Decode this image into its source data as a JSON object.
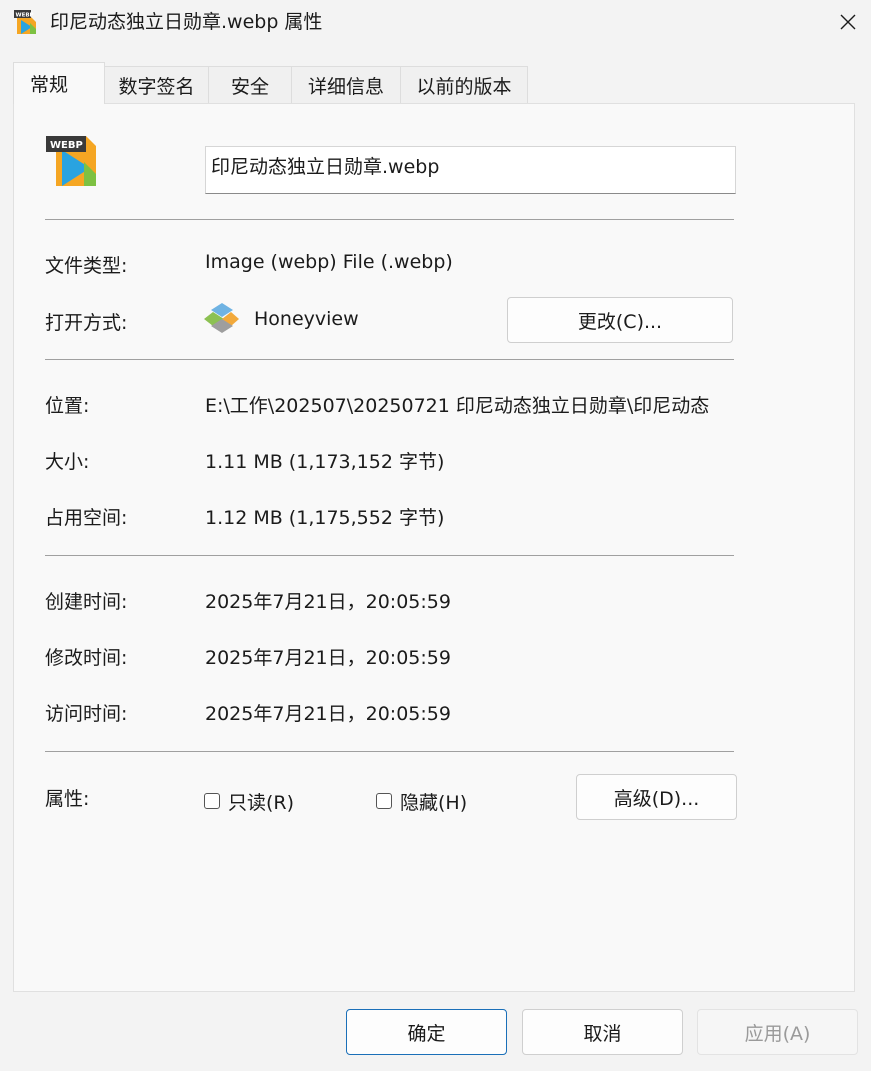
{
  "window": {
    "title": "印尼动态独立日勋章.webp 属性",
    "app_icon": "webp-file-icon",
    "close_icon": "close-icon"
  },
  "tabs": [
    {
      "label": "常规",
      "active": true
    },
    {
      "label": "数字签名",
      "active": false
    },
    {
      "label": "安全",
      "active": false
    },
    {
      "label": "详细信息",
      "active": false
    },
    {
      "label": "以前的版本",
      "active": false
    }
  ],
  "general": {
    "file_icon_badge": "WEBP",
    "file_name": "印尼动态独立日勋章.webp",
    "file_type_label": "文件类型:",
    "file_type_value": "Image (webp) File (.webp)",
    "opens_with_label": "打开方式:",
    "opens_with_app": "Honeyview",
    "change_button": "更改(C)...",
    "location_label": "位置:",
    "location_value": "E:\\工作\\202507\\20250721 印尼动态独立日勋章\\印尼动态",
    "size_label": "大小:",
    "size_value": "1.11 MB (1,173,152 字节)",
    "size_on_disk_label": "占用空间:",
    "size_on_disk_value": "1.12 MB (1,175,552 字节)",
    "created_label": "创建时间:",
    "created_value": "2025年7月21日，20:05:59",
    "modified_label": "修改时间:",
    "modified_value": "2025年7月21日，20:05:59",
    "accessed_label": "访问时间:",
    "accessed_value": "2025年7月21日，20:05:59",
    "attributes_label": "属性:",
    "readonly_label": "只读(R)",
    "readonly_checked": false,
    "hidden_label": "隐藏(H)",
    "hidden_checked": false,
    "advanced_button": "高级(D)..."
  },
  "footer": {
    "ok": "确定",
    "cancel": "取消",
    "apply": "应用(A)"
  },
  "colors": {
    "window_bg": "#f3f3f3",
    "panel_bg": "#f9f9f9",
    "accent_border": "#1a6fb8",
    "disabled_text": "#9a9a9a"
  }
}
